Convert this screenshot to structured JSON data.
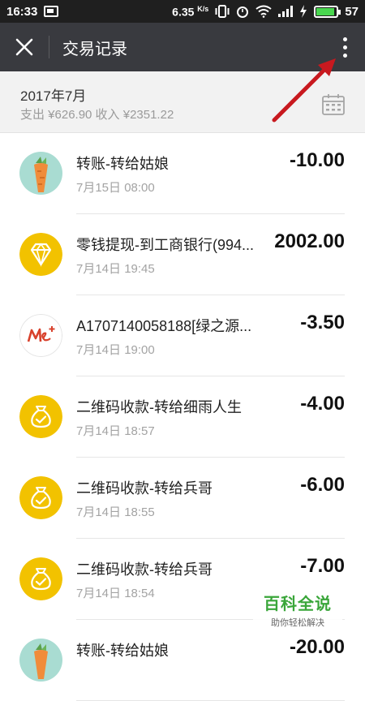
{
  "status_bar": {
    "time": "16:33",
    "speed_value": "6.35",
    "speed_unit": "K/s",
    "battery": "57"
  },
  "header": {
    "title": "交易记录",
    "close_icon": "close-icon",
    "more_icon": "more-vertical-icon"
  },
  "month": {
    "title": "2017年7月",
    "summary": "支出 ¥626.90 收入 ¥2351.22",
    "calendar_icon": "calendar-icon"
  },
  "transactions": [
    {
      "title": "转账-转给姑娘",
      "date": "7月15日 08:00",
      "amount": "-10.00",
      "icon": "carrot-avatar"
    },
    {
      "title": "零钱提现-到工商银行(994...",
      "date": "7月14日 19:45",
      "amount": "2002.00",
      "icon": "diamond-icon"
    },
    {
      "title": "A1707140058188[绿之源...",
      "date": "7月14日 19:00",
      "amount": "-3.50",
      "icon": "merchant-logo"
    },
    {
      "title": "二维码收款-转给细雨人生",
      "date": "7月14日 18:57",
      "amount": "-4.00",
      "icon": "money-bag-icon"
    },
    {
      "title": "二维码收款-转给兵哥",
      "date": "7月14日 18:55",
      "amount": "-6.00",
      "icon": "money-bag-icon"
    },
    {
      "title": "二维码收款-转给兵哥",
      "date": "7月14日 18:54",
      "amount": "-7.00",
      "icon": "money-bag-icon"
    },
    {
      "title": "转账-转给姑娘",
      "date": "",
      "amount": "-20.00",
      "icon": "carrot-avatar"
    }
  ],
  "watermark": {
    "main": "百科全说",
    "sub": "助你轻松解决"
  },
  "colors": {
    "topbar": "#393a3f",
    "gold": "#f2c200",
    "arrow": "#c8191f",
    "watermark_green": "#3aa63a"
  }
}
